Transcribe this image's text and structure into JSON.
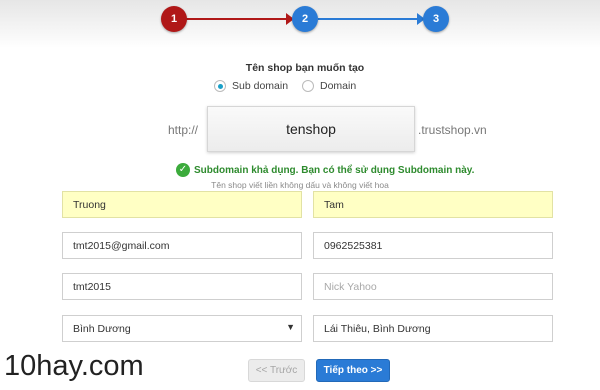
{
  "stepper": {
    "steps": [
      "1",
      "2",
      "3"
    ],
    "active_step": 2
  },
  "form": {
    "title": "Tên shop bạn muốn tạo",
    "radio": {
      "options": [
        "Sub domain",
        "Domain"
      ],
      "selected": "Sub domain"
    },
    "domain": {
      "prefix": "http://",
      "value": "tenshop",
      "suffix": ".trustshop.vn"
    },
    "status_message": "Subdomain khả dụng. Bạn có thể sử dụng Subdomain này.",
    "hint": "Tên shop viết liền không dấu và không viết hoa",
    "fields": {
      "first_name": "Truong",
      "last_name": "Tam",
      "email": "tmt2015@gmail.com",
      "phone": "0962525381",
      "username": "tmt2015",
      "yahoo_placeholder": "Nick Yahoo",
      "province": "Bình Dương",
      "address": "Lái Thiêu, Bình Dương"
    },
    "buttons": {
      "prev": "<< Trước",
      "next": "Tiếp theo >>"
    }
  },
  "colors": {
    "step_done": "#b01818",
    "step_active": "#2a7bd6",
    "highlight_field": "#ffffc4",
    "success": "#2e8b2e"
  },
  "watermark": "10hay.com"
}
